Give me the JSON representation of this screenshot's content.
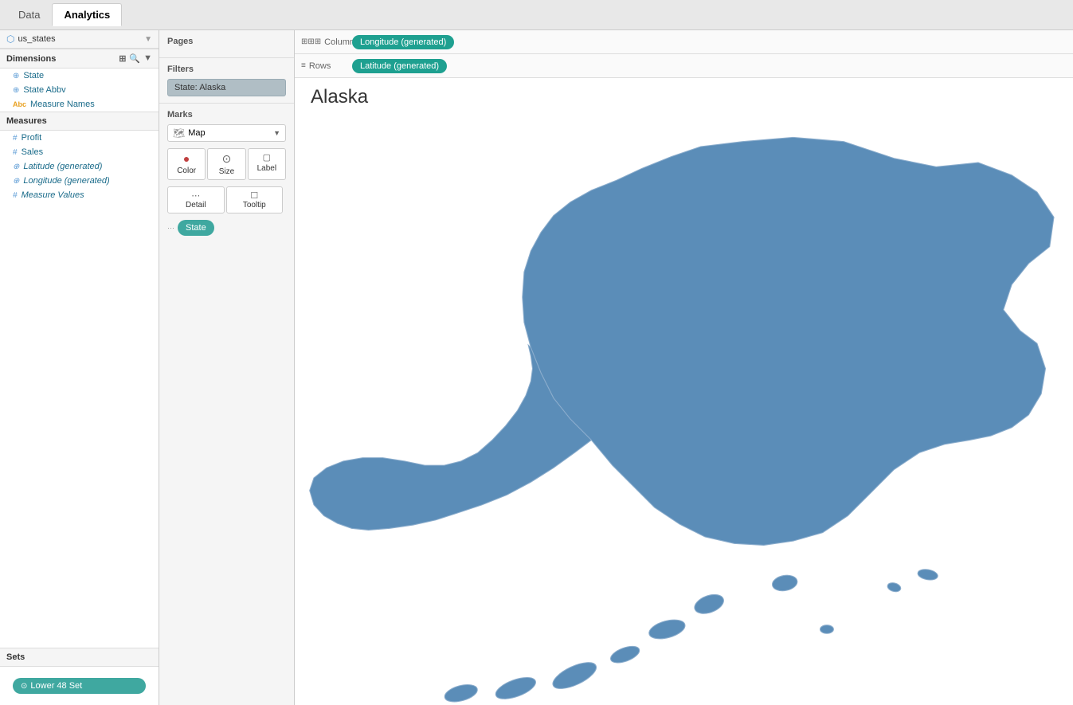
{
  "tabs": {
    "data_label": "Data",
    "analytics_label": "Analytics"
  },
  "left_panel": {
    "source_name": "us_states",
    "dimensions_label": "Dimensions",
    "fields": [
      {
        "name": "State",
        "icon": "globe",
        "type": "dim"
      },
      {
        "name": "State Abbv",
        "icon": "globe",
        "type": "dim"
      },
      {
        "name": "Measure Names",
        "icon": "abc",
        "type": "dim"
      }
    ],
    "measures_label": "Measures",
    "measures": [
      {
        "name": "Profit",
        "icon": "hash",
        "type": "measure"
      },
      {
        "name": "Sales",
        "icon": "hash",
        "type": "measure"
      },
      {
        "name": "Latitude (generated)",
        "icon": "globe",
        "type": "measure",
        "italic": true
      },
      {
        "name": "Longitude (generated)",
        "icon": "globe",
        "type": "measure",
        "italic": true
      },
      {
        "name": "Measure Values",
        "icon": "hash",
        "type": "measure",
        "italic": true
      }
    ],
    "sets_label": "Sets",
    "lower48_set": "Lower 48 Set"
  },
  "middle_panel": {
    "pages_label": "Pages",
    "filters_label": "Filters",
    "filter_value": "State: Alaska",
    "marks_label": "Marks",
    "marks_type": "Map",
    "mark_buttons": [
      {
        "label": "Color",
        "icon": "⬡"
      },
      {
        "label": "Size",
        "icon": "⊙"
      },
      {
        "label": "Label",
        "icon": "▢"
      }
    ],
    "mark_buttons2": [
      {
        "label": "Detail",
        "icon": "⋯"
      },
      {
        "label": "Tooltip",
        "icon": "☐"
      }
    ],
    "state_detail": "State"
  },
  "canvas": {
    "columns_label": "Columns",
    "columns_pill": "Longitude (generated)",
    "rows_label": "Rows",
    "rows_pill": "Latitude (generated)",
    "view_title": "Alaska"
  }
}
